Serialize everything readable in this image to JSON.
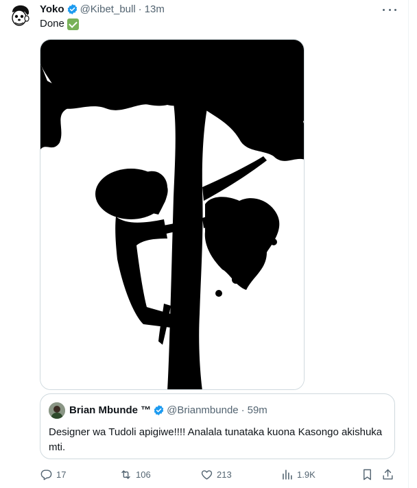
{
  "tweet": {
    "display_name": "Yoko",
    "handle": "@Kibet_bull",
    "separator": "·",
    "time": "13m",
    "text": "Done",
    "text_emoji": "check-mark-button-emoji"
  },
  "quote": {
    "display_name": "Brian Mbunde ™",
    "handle": "@Brianmbunde",
    "separator": "·",
    "time": "59m",
    "text": "Designer wa Tudoli apigiwe!!!! Analala tunataka kuona Kasongo akishuka mti."
  },
  "actions": {
    "replies": "17",
    "reposts": "106",
    "likes": "213",
    "views": "1.9K"
  },
  "colors": {
    "verified": "#1d9bf0",
    "muted_text": "#536471",
    "border": "#cfd9de",
    "check_emoji": "#78b159"
  }
}
